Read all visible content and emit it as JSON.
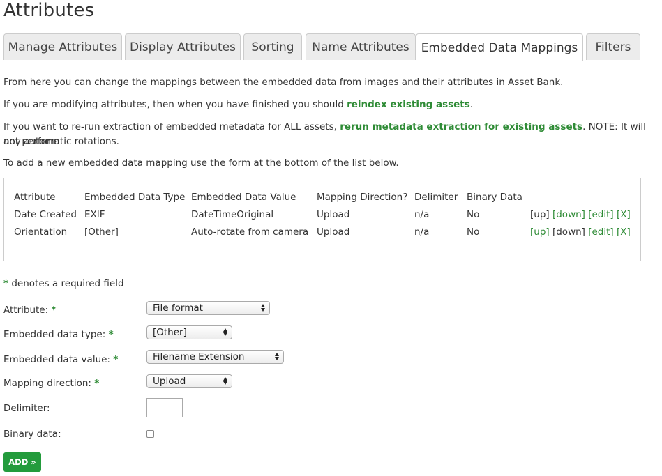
{
  "page_title": "Attributes",
  "tabs": [
    {
      "label": "Manage Attributes"
    },
    {
      "label": "Display Attributes"
    },
    {
      "label": "Sorting"
    },
    {
      "label": "Name Attributes"
    },
    {
      "label": "Embedded Data Mappings"
    },
    {
      "label": "Filters"
    }
  ],
  "active_tab": "Embedded Data Mappings",
  "intro": {
    "line1": "From here you can change the mappings between the embedded data from images and their attributes in Asset Bank.",
    "line2_pre": "If you are modifying attributes, then when you have finished you should ",
    "line2_link": "reindex existing assets",
    "line2_post": ".",
    "line3_pre": "If you want to re-run extraction of embedded metadata for ALL assets, ",
    "line3_link": "rerun metadata extraction for existing assets",
    "line3_post": ". NOTE: It will not perform",
    "line3b": "any automatic rotations.",
    "line4": "To add a new embedded data mapping use the form at the bottom of the list below."
  },
  "table": {
    "headers": [
      "Attribute",
      "Embedded Data Type",
      "Embedded Data Value",
      "Mapping Direction?",
      "Delimiter",
      "Binary Data"
    ],
    "rows": [
      {
        "attribute": "Date Created",
        "type": "EXIF",
        "value": "DateTimeOriginal",
        "direction": "Upload",
        "delimiter": "n/a",
        "binary": "No",
        "up": "[up]",
        "down": "[down]",
        "edit": "[edit]",
        "delete": "[X]"
      },
      {
        "attribute": "Orientation",
        "type": "[Other]",
        "value": "Auto-rotate from camera",
        "direction": "Upload",
        "delimiter": "n/a",
        "binary": "No",
        "up": "[up]",
        "down": "[down]",
        "edit": "[edit]",
        "delete": "[X]"
      }
    ]
  },
  "form": {
    "required_star": "*",
    "required_note": " denotes a required field",
    "attribute_label": "Attribute:",
    "attribute_value": "File format",
    "type_label": "Embedded data type:",
    "type_value": "[Other]",
    "value_label": "Embedded data value:",
    "value_value": "Filename Extension",
    "direction_label": "Mapping direction:",
    "direction_value": "Upload",
    "delimiter_label": "Delimiter:",
    "delimiter_value": "",
    "binary_label": "Binary data:",
    "binary_checked": false,
    "add_button": "ADD »"
  },
  "colors": {
    "link": "#2e8b35",
    "button": "#239b3c"
  }
}
